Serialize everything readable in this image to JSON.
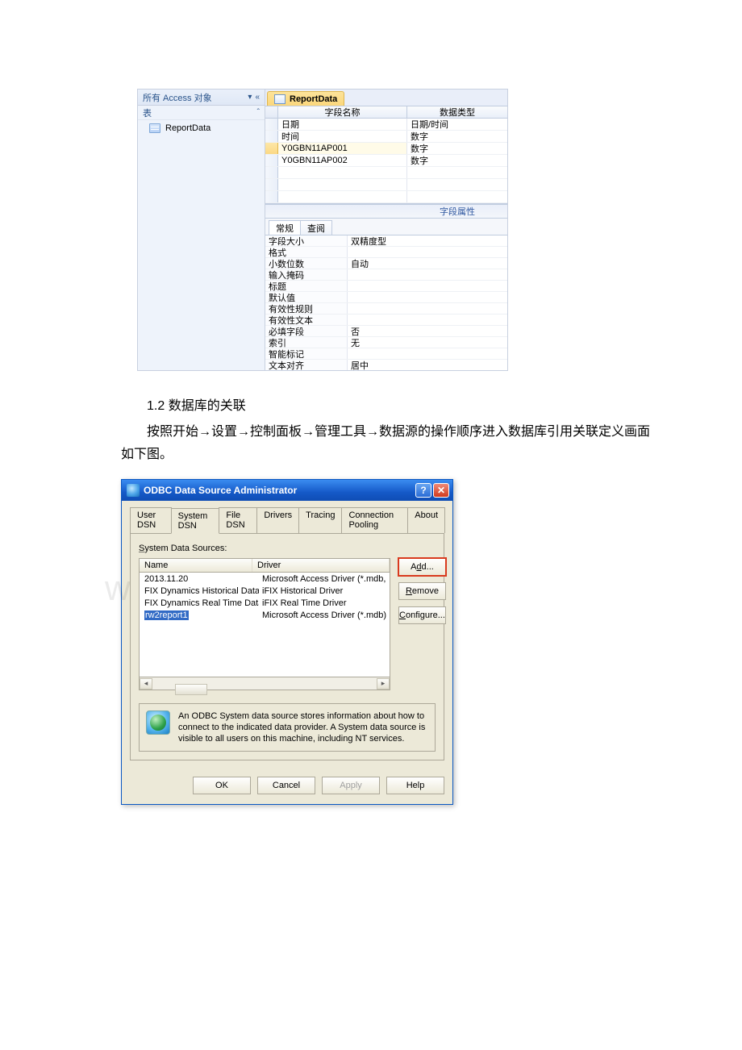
{
  "watermark": "www.bdocx.com",
  "access": {
    "nav_title": "所有 Access 对象",
    "nav_group": "表",
    "nav_item": "ReportData",
    "tab_name": "ReportData",
    "grid": {
      "col1": "字段名称",
      "col2": "数据类型",
      "rows": [
        {
          "name": "日期",
          "type": "日期/时间"
        },
        {
          "name": "时间",
          "type": "数字"
        },
        {
          "name": "Y0GBN11AP001",
          "type": "数字",
          "sel": true
        },
        {
          "name": "Y0GBN11AP002",
          "type": "数字"
        }
      ]
    },
    "prop_title": "字段属性",
    "prop_tabs": {
      "t1": "常规",
      "t2": "查阅"
    },
    "props": [
      {
        "label": "字段大小",
        "value": "双精度型"
      },
      {
        "label": "格式",
        "value": ""
      },
      {
        "label": "小数位数",
        "value": "自动"
      },
      {
        "label": "输入掩码",
        "value": ""
      },
      {
        "label": "标题",
        "value": ""
      },
      {
        "label": "默认值",
        "value": ""
      },
      {
        "label": "有效性规则",
        "value": ""
      },
      {
        "label": "有效性文本",
        "value": ""
      },
      {
        "label": "必填字段",
        "value": "否"
      },
      {
        "label": "索引",
        "value": "无"
      },
      {
        "label": "智能标记",
        "value": ""
      },
      {
        "label": "文本对齐",
        "value": "居中"
      }
    ]
  },
  "body": {
    "heading": "1.2 数据库的关联",
    "para": "按照开始→设置→控制面板→管理工具→数据源的操作顺序进入数据库引用关联定义画面如下图。"
  },
  "odbc": {
    "title": "ODBC Data Source Administrator",
    "help_glyph": "?",
    "close_glyph": "✕",
    "tabs": {
      "user": "User DSN",
      "system": "System DSN",
      "file": "File DSN",
      "drivers": "Drivers",
      "tracing": "Tracing",
      "pool": "Connection Pooling",
      "about": "About"
    },
    "ds_label": "System Data Sources:",
    "cols": {
      "name": "Name",
      "driver": "Driver"
    },
    "rows": [
      {
        "name": "2013.11.20",
        "driver": "Microsoft Access Driver (*.mdb,"
      },
      {
        "name": "FIX Dynamics Historical Data",
        "driver": "iFIX Historical Driver"
      },
      {
        "name": "FIX Dynamics Real Time Data",
        "driver": "iFIX Real Time Driver"
      },
      {
        "name": "rw2report1",
        "driver": "Microsoft Access Driver (*.mdb)",
        "sel": true
      }
    ],
    "buttons": {
      "add": "Add...",
      "remove": "Remove",
      "configure": "Configure..."
    },
    "info": "An ODBC System data source stores information about how to connect to the indicated data provider.  A System data source is visible to all users on this machine, including NT services.",
    "dlg": {
      "ok": "OK",
      "cancel": "Cancel",
      "apply": "Apply",
      "help": "Help"
    }
  }
}
